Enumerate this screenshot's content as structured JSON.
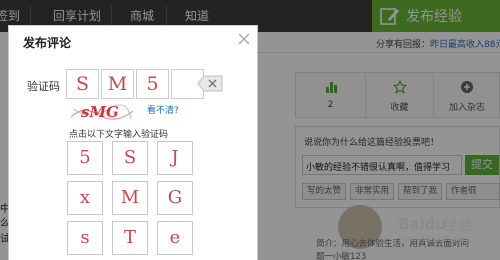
{
  "topnav": {
    "items": [
      "签到",
      "回享计划",
      "商城",
      "知道"
    ],
    "publish_label": "发布经验"
  },
  "article": {
    "share_text": "分享有回报：",
    "share_link": "昨日最高收入88元",
    "actions": [
      {
        "icon": "bar-chart-icon",
        "label": "2"
      },
      {
        "icon": "star-icon",
        "label": "收藏"
      },
      {
        "icon": "plus-icon",
        "label": "加入杂志"
      }
    ],
    "vote_title": "说说你为什么给这篇经验投票吧！",
    "vote_input": "小敏的经验不错很认真啊，值得学习",
    "vote_submit": "提交",
    "vote_tags": [
      "写的太赞",
      "非常实用",
      "帮到了我",
      "作者很"
    ],
    "left_fragments": [
      "中",
      "么",
      "试"
    ],
    "intro_line1": "简介：用心去体验生活，用真诚去面对问",
    "intro_line2": "题一小敏123",
    "watermark": {
      "brand": "Baidu",
      "suffix": "经验",
      "url": "jingyan.baidu.com"
    }
  },
  "dialog": {
    "title": "发布评论",
    "captcha_label": "验证码",
    "entered": [
      "S",
      "M",
      "5",
      ""
    ],
    "captcha_image_text": "sMG",
    "refresh_link": "看不清?",
    "hint": "点击以下文字输入验证码",
    "grid": [
      "5",
      "S",
      "J",
      "x",
      "M",
      "G",
      "s",
      "T",
      "e"
    ]
  },
  "colors": {
    "nav_bg": "#3d3d3d",
    "publish_green": "#6ab738",
    "captcha_red": "#c24a4a",
    "link_blue": "#2467b8",
    "overlay": "rgba(0,0,0,0.42)"
  }
}
